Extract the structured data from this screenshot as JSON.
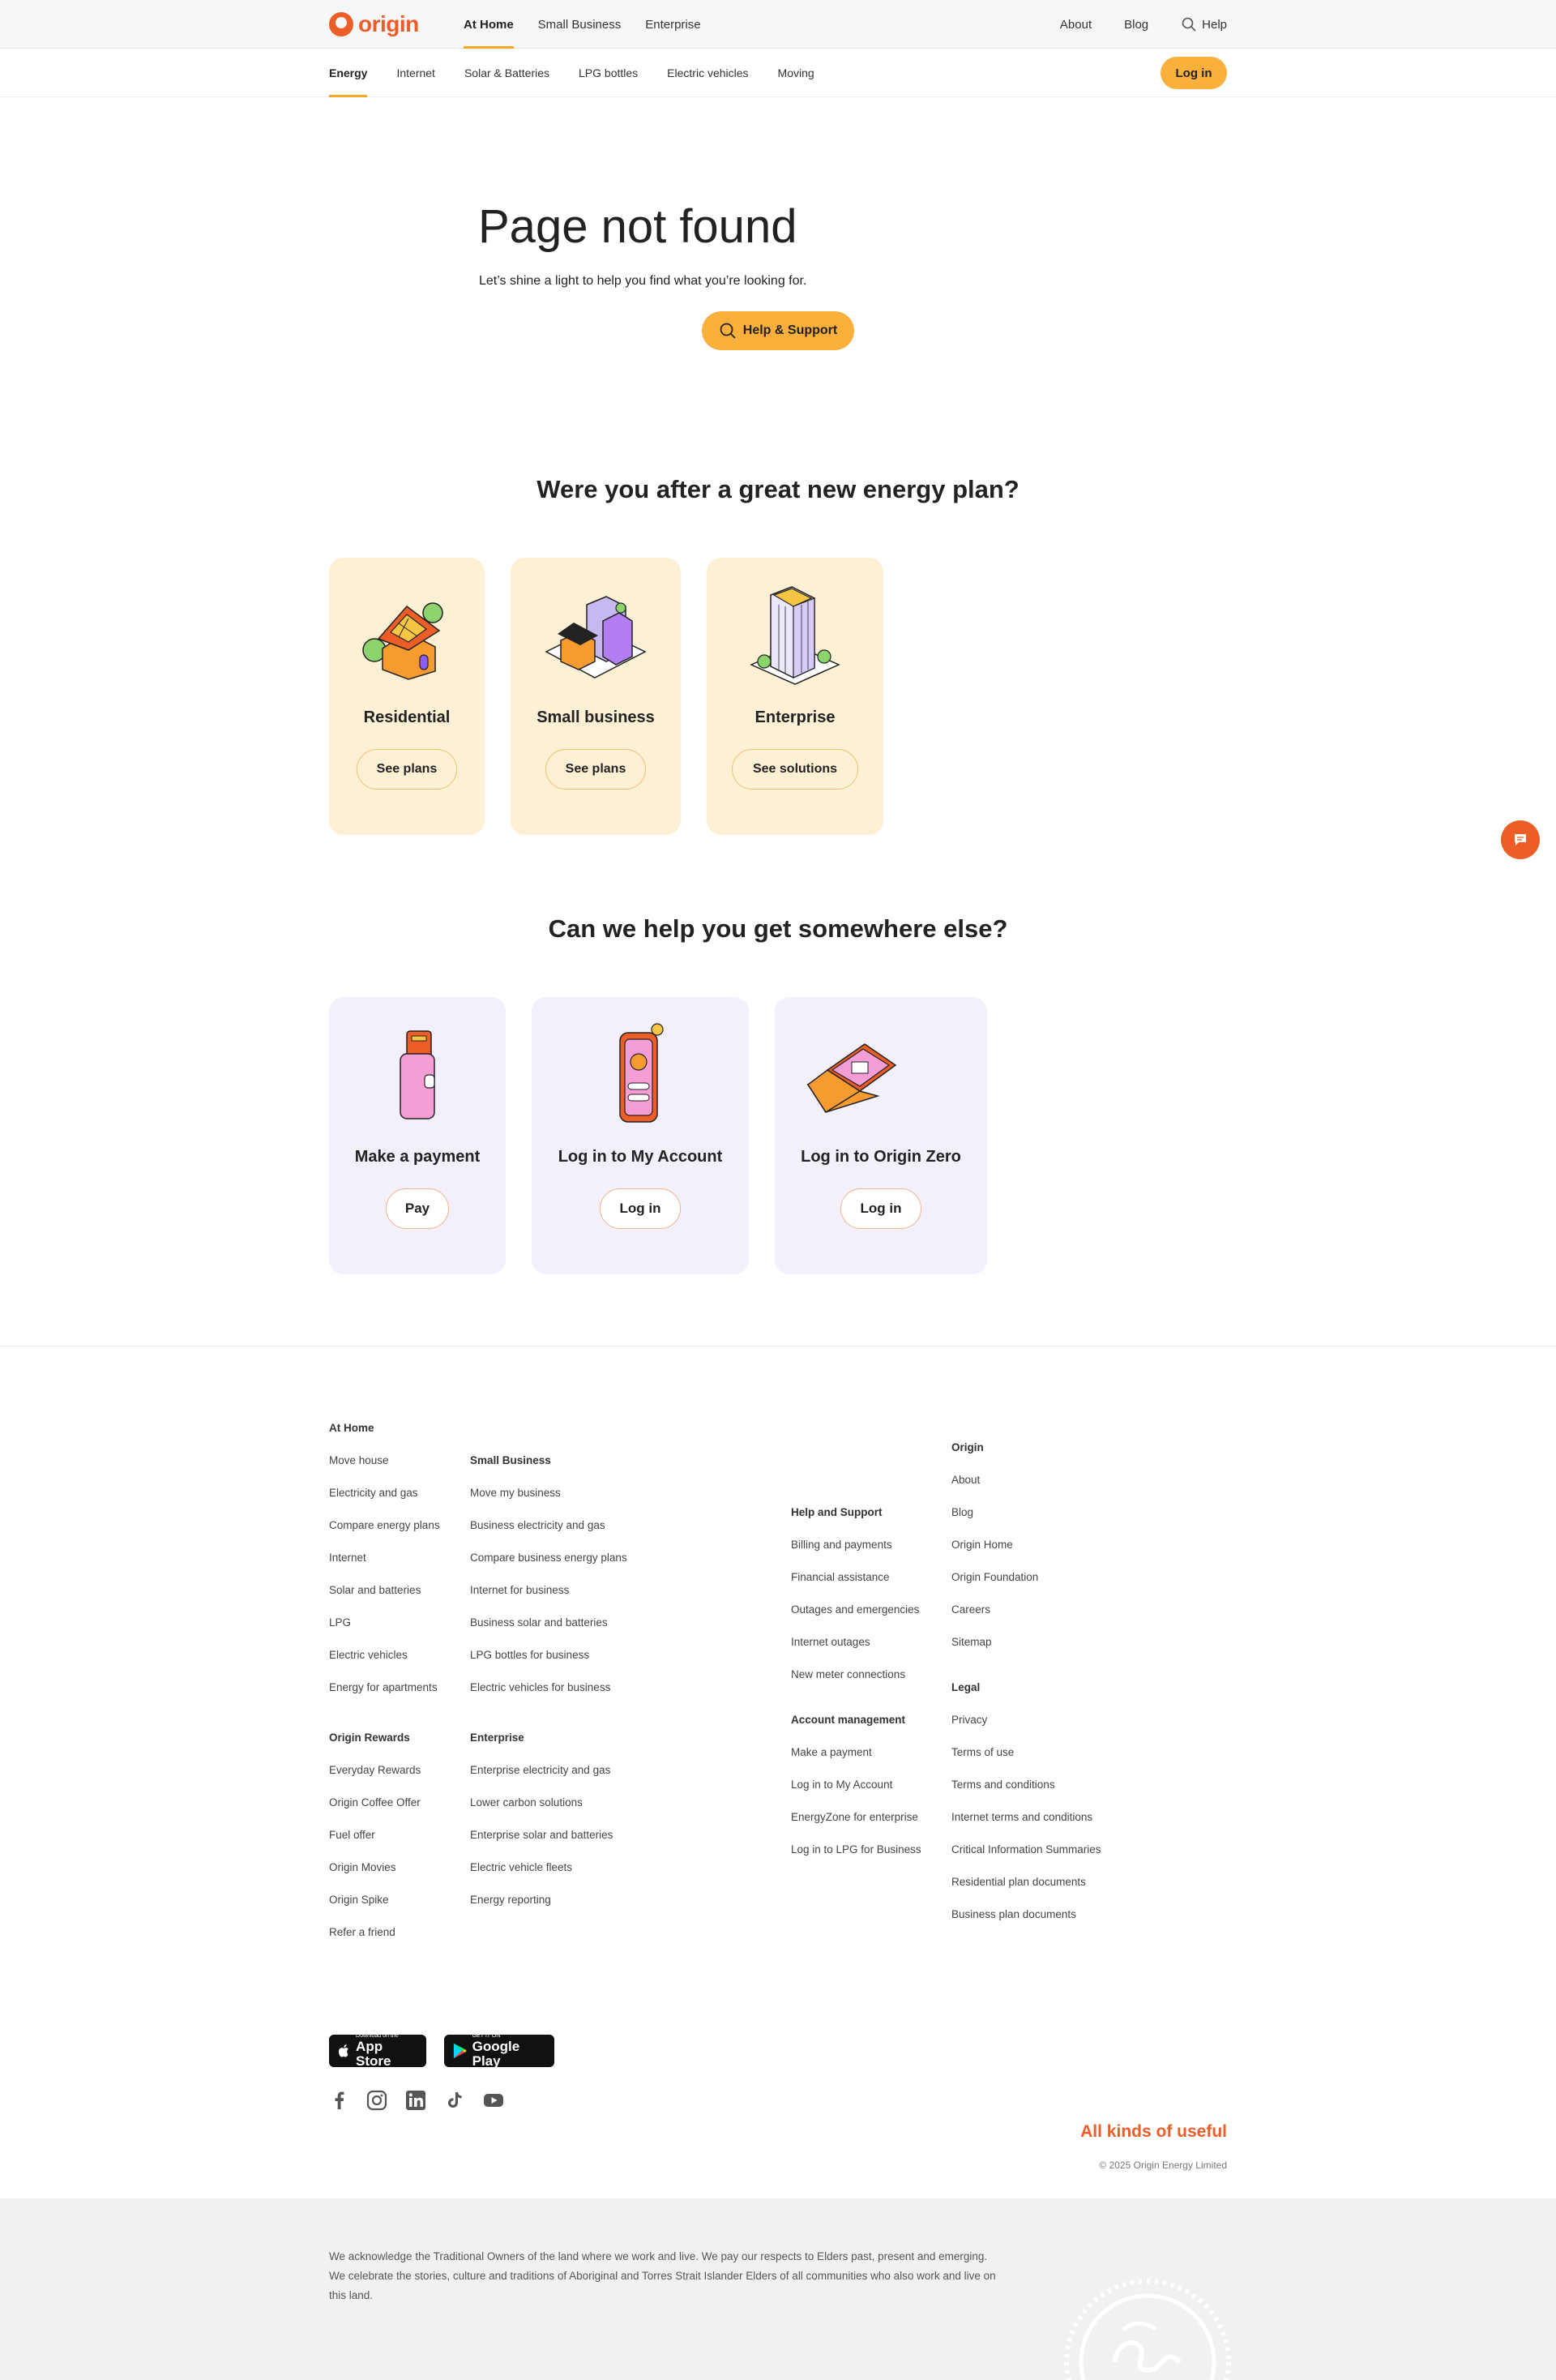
{
  "brand": {
    "name": "origin",
    "color": "#ec5d28",
    "accent": "#fbb03b"
  },
  "header": {
    "nav": [
      "At Home",
      "Small Business",
      "Enterprise"
    ],
    "active_nav": "At Home",
    "right": {
      "about": "About",
      "blog": "Blog",
      "help": "Help"
    }
  },
  "subnav": {
    "items": [
      "Energy",
      "Internet",
      "Solar & Batteries",
      "LPG bottles",
      "Electric vehicles",
      "Moving"
    ],
    "active": "Energy",
    "login": "Log in"
  },
  "hero": {
    "title": "Page not found",
    "subtitle": "Let’s shine a light to help you find what you’re looking for.",
    "button": "Help & Support"
  },
  "energy_section": {
    "title": "Were you after a great new energy plan?",
    "cards": [
      {
        "title": "Residential",
        "button": "See plans",
        "icon": "house-icon"
      },
      {
        "title": "Small business",
        "button": "See plans",
        "icon": "shops-icon"
      },
      {
        "title": "Enterprise",
        "button": "See solutions",
        "icon": "office-building-icon"
      }
    ]
  },
  "help_section": {
    "title": "Can we help you get somewhere else?",
    "cards": [
      {
        "title": "Make a payment",
        "button": "Pay",
        "icon": "wallet-icon"
      },
      {
        "title": "Log in to My Account",
        "button": "Log in",
        "icon": "phone-account-icon"
      },
      {
        "title": "Log in to Origin Zero",
        "button": "Log in",
        "icon": "laptop-icon"
      }
    ]
  },
  "footer": {
    "at_home": {
      "head": "At Home",
      "links": [
        "Move house",
        "Electricity and gas",
        "Compare energy plans",
        "Internet",
        "Solar and batteries",
        "LPG",
        "Electric vehicles",
        "Energy for apartments"
      ]
    },
    "origin_rewards": {
      "head": "Origin Rewards",
      "links": [
        "Everyday Rewards",
        "Origin Coffee Offer",
        "Fuel offer",
        "Origin Movies",
        "Origin Spike",
        "Refer a friend"
      ]
    },
    "small_business": {
      "head": "Small Business",
      "links": [
        "Move my business",
        "Business electricity and gas",
        "Compare business energy plans",
        "Internet for business",
        "Business solar and batteries",
        "LPG bottles for business",
        "Electric vehicles for business"
      ]
    },
    "enterprise": {
      "head": "Enterprise",
      "links": [
        "Enterprise electricity and gas",
        "Lower carbon solutions",
        "Enterprise solar and batteries",
        "Electric vehicle fleets",
        "Energy reporting"
      ]
    },
    "help_support": {
      "head": "Help and Support",
      "links": [
        "Billing and payments",
        "Financial assistance",
        "Outages and emergencies",
        "Internet outages",
        "New meter connections"
      ]
    },
    "account": {
      "head": "Account management",
      "links": [
        "Make a payment",
        "Log in to My Account",
        "EnergyZone for enterprise",
        "Log in to LPG for Business"
      ]
    },
    "origin": {
      "head": "Origin",
      "links": [
        "About",
        "Blog",
        "Origin Home",
        "Origin Foundation",
        "Careers",
        "Sitemap"
      ]
    },
    "legal": {
      "head": "Legal",
      "links": [
        "Privacy",
        "Terms of use",
        "Terms and conditions",
        "Internet terms and conditions",
        "Critical Information Summaries",
        "Residential plan documents",
        "Business plan documents"
      ]
    },
    "app_store": {
      "small": "Download on the",
      "big": "App Store"
    },
    "google_play": {
      "small": "GET IT ON",
      "big": "Google Play"
    },
    "social": [
      "facebook-icon",
      "instagram-icon",
      "linkedin-icon",
      "tiktok-icon",
      "youtube-icon"
    ],
    "tagline": "All kinds of useful",
    "copyright": "© 2025 Origin Energy Limited",
    "acknowledgement": "We acknowledge the Traditional Owners of the land where we work and live. We pay our respects to Elders past, present and emerging. We celebrate the stories, culture and traditions of Aboriginal and Torres Strait Islander Elders of all communities who also work and live on this land."
  }
}
